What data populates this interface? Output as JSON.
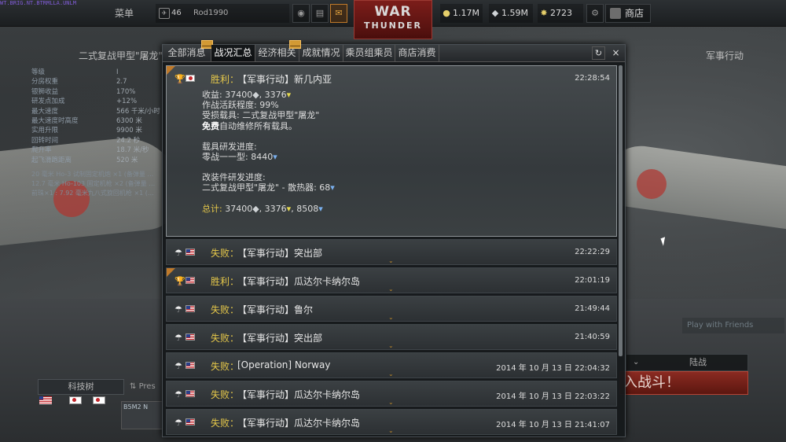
{
  "topbar": {
    "link_text": "WT.BRIG.NT.BTRMLLA.UNLM",
    "menu": "菜单",
    "player_rank": "46",
    "player_name": "Rod1990",
    "gold": "1.17M",
    "silver": "1.59M",
    "rp": "2723",
    "shop": "商店",
    "logo_line1": "WAR",
    "logo_line2": "THUNDER"
  },
  "background": {
    "vehicle_title": "二式复战甲型\"屠龙\"",
    "mode_title": "军事行动",
    "stats": [
      {
        "label": "等级",
        "value": "I"
      },
      {
        "label": "分房权重",
        "value": "2.7"
      },
      {
        "label": "银狮收益",
        "value": "170%"
      },
      {
        "label": "研发点加成",
        "value": "+12%"
      },
      {
        "label": "最大速度",
        "value": "566 千米/小时"
      },
      {
        "label": "最大速度时高度",
        "value": "6300 米"
      },
      {
        "label": "实用升限",
        "value": "9900 米"
      },
      {
        "label": "回转时间",
        "value": "24.2 秒"
      },
      {
        "label": "爬升率",
        "value": "18.7 米/秒"
      },
      {
        "label": "起飞滑跑距离",
        "value": "520 米"
      }
    ],
    "weapons": [
      "20 毫米 Ho-3 试制固定机炮 ×1 (备弹量 …",
      "12.7 毫米 Ho-103 固定机枪 ×2 (备弹量 …",
      "前珠×1 : 7.92 毫米九八式旋回机枪 ×1 (…"
    ],
    "tech_tree": "科技树",
    "preset": "Pres",
    "slot_label": "B5M2 N",
    "play_with_friends": "Play with Friends",
    "mode_label": "陆战",
    "battle_button": "入战斗！"
  },
  "dialog": {
    "tabs": [
      {
        "label": "全部消息",
        "badge": true
      },
      {
        "label": "战况汇总",
        "active": true
      },
      {
        "label": "经济相关",
        "badge": true
      },
      {
        "label": "成就情况"
      },
      {
        "label": "乘员组乘员"
      },
      {
        "label": "商店消费"
      }
    ],
    "refresh_icon": "↻",
    "close_icon": "×",
    "colors": {
      "win": "#e6c84a",
      "accent": "#c07a2a",
      "dialog_bg": "#16191b"
    },
    "expanded": {
      "result": "胜利：",
      "title": "【军事行动】新几内亚",
      "time": "22:28:54",
      "earnings_label": "收益: ",
      "earnings_silver": "37400",
      "earnings_rp": "3376",
      "activity": "作战活跃程度: 99%",
      "damaged": "受损载具: 二式复战甲型\"屠龙\"",
      "repair_bold": "免费",
      "repair_rest": "自动维修所有载具。",
      "research_head": "载具研发进度:",
      "research_line_label": "零战一一型: ",
      "research_line_value": "8440",
      "mod_head": "改装件研发进度:",
      "mod_line_label": "二式复战甲型\"屠龙\" - 散热器: ",
      "mod_line_value": "68",
      "total_label": "总计: ",
      "total_silver": "37400",
      "total_rp": "3376",
      "total_research": "8508"
    },
    "entries": [
      {
        "result": "失败：",
        "title": "【军事行动】突出部",
        "time": "22:22:29",
        "new": false
      },
      {
        "result": "胜利：",
        "title": "【军事行动】瓜达尔卡纳尔岛",
        "time": "22:01:19",
        "new": true
      },
      {
        "result": "失败：",
        "title": "【军事行动】鲁尔",
        "time": "21:49:44",
        "new": false
      },
      {
        "result": "失败：",
        "title": "【军事行动】突出部",
        "time": "21:40:59",
        "new": false
      },
      {
        "result": "失败：",
        "title": "[Operation] Norway",
        "time": "2014 年 10 月 13 日 22:04:32",
        "new": false
      },
      {
        "result": "失败：",
        "title": "【军事行动】瓜达尔卡纳尔岛",
        "time": "2014 年 10 月 13 日 22:03:22",
        "new": false
      },
      {
        "result": "失败：",
        "title": "【军事行动】瓜达尔卡纳尔岛",
        "time": "2014 年 10 月 13 日 21:41:07",
        "new": false
      }
    ]
  }
}
